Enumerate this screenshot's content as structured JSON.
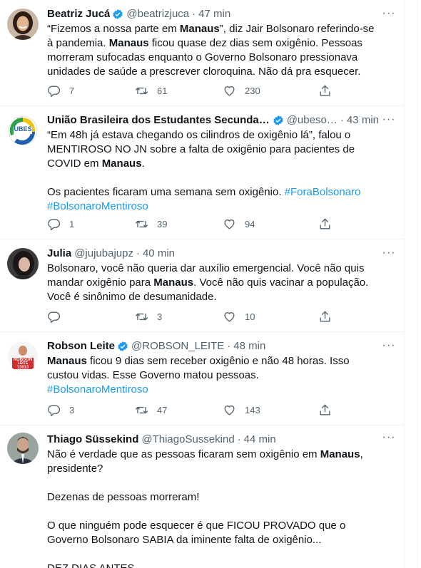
{
  "tweets": [
    {
      "name": "Beatriz Jucá",
      "handle": "@beatrizjuca",
      "time": "47 min",
      "verified": true,
      "text_parts": [
        [
          "“Fizemos a nossa parte em ",
          "Manaus",
          "”, diz Jair Bolsonaro referindo-se à pandemia. ",
          "Manaus",
          " ficou quase dez dias sem oxigênio. Pessoas morreram sufocadas enquanto o Governo Bolsonaro pressionava unidades de saúde a prescrever cloroquina. Não dá pra esquecer."
        ]
      ],
      "replies": "7",
      "retweets": "61",
      "likes": "230"
    },
    {
      "name": "União Brasileira dos Estudantes Secundari...",
      "handle": "@ubesof...",
      "time": "43 min",
      "verified": true,
      "line1_a": "“Em 48h já estava chegando os cilindros de oxigênio lá”, falou o MENTIROSO NO JN sobre a falta de oxigênio para pacientes de COVID em ",
      "line1_b": "Manaus",
      "line1_c": ".",
      "line2_a": "Os pacientes ficaram uma semana sem oxigênio. ",
      "tag1": "#ForaBolsonaro",
      "tag2": "#BolsonaroMentiroso",
      "avatar_label": "UBES",
      "replies": "1",
      "retweets": "39",
      "likes": "94"
    },
    {
      "name": "Julia",
      "handle": "@jujubajupz",
      "time": "40 min",
      "verified": false,
      "t_a": "Bolsonaro, você não queria dar auxílio emergencial. Você não quis mandar oxigênio para ",
      "t_b": "Manaus",
      "t_c": ". Você não quis vacinar a população. Você é sinônimo de desumanidade.",
      "replies": "",
      "retweets": "3",
      "likes": "10"
    },
    {
      "name": "Robson Leite",
      "handle": "@ROBSON_LEITE",
      "time": "48 min",
      "verified": true,
      "t_a": "Manaus",
      "t_b": " ficou 9 dias sem receber oxigênio e não 48 horas. Isso custou vidas. Esse Governo matou pessoas.",
      "tag": "#BolsonaroMentiroso",
      "avatar_top": "ROBSON",
      "avatar_mid": "LEITE",
      "avatar_num": "13013",
      "replies": "3",
      "retweets": "47",
      "likes": "143"
    },
    {
      "name": "Thiago Süssekind",
      "handle": "@ThiagoSussekind",
      "time": "44 min",
      "verified": false,
      "p1_a": "Não é verdade que as pessoas ficaram sem oxigênio em ",
      "p1_b": "Manaus",
      "p1_c": ", presidente?",
      "p2": "Dezenas de pessoas morreram!",
      "p3": "O que ninguém pode esquecer é que FICOU PROVADO que o Governo Bolsonaro SABIA da iminente falta de oxigênio...",
      "p4": "DEZ DIAS ANTES."
    }
  ],
  "colors": {
    "accent": "#1d9bf0",
    "text": "#0f1419",
    "muted": "#536471"
  },
  "icons": [
    "reply-icon",
    "retweet-icon",
    "like-icon",
    "share-icon",
    "verified-badge-icon",
    "more-icon"
  ]
}
